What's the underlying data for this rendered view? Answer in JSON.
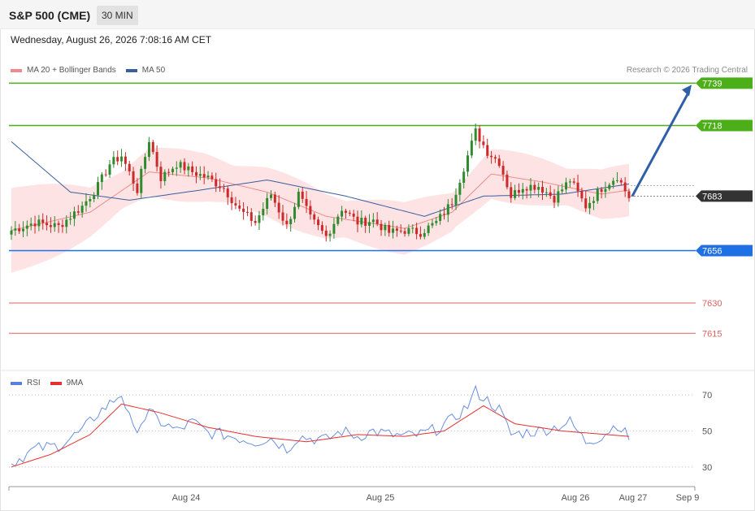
{
  "header": {
    "title": "S&P 500 (CME)",
    "interval": "30 MIN"
  },
  "datetime": "Wednesday, August 26, 2026 7:08:16 AM CET",
  "legend": {
    "ma20": "MA 20 + Bollinger Bands",
    "ma50": "MA 50"
  },
  "rsi_legend": {
    "rsi": "RSI",
    "ma9": "9MA"
  },
  "copyright": "Research © 2026 Trading Central",
  "colors": {
    "bull": "#2e8b2e",
    "bear": "#cc2a2a",
    "band": "#fde3e3",
    "ma20": "#f08a8a",
    "ma50": "#3a5fa0",
    "arrow": "#2f5fa8",
    "resistance": "#4caf1a",
    "support": "#1f6fe5",
    "redline": "#e06060",
    "current": "#333333",
    "rsi": "#6a8fe0",
    "rsi_ma": "#e53030"
  },
  "chart_data": [
    {
      "type": "candlestick",
      "title": "S&P 500 (CME)",
      "interval": "30 MIN",
      "ylim": [
        7597,
        7748
      ],
      "x_ticks": [
        "Aug 24",
        "Aug 25",
        "Aug 26",
        "Aug 27",
        "Sep 9"
      ],
      "y_levels": [
        {
          "value": 7739,
          "label": "7739",
          "kind": "resistance"
        },
        {
          "value": 7718,
          "label": "7718",
          "kind": "resistance"
        },
        {
          "value": 7683,
          "label": "7683",
          "kind": "current"
        },
        {
          "value": 7656,
          "label": "7656",
          "kind": "support"
        },
        {
          "value": 7630,
          "label": "7630",
          "kind": "redline"
        },
        {
          "value": 7615,
          "label": "7615",
          "kind": "redline"
        }
      ],
      "arrow": {
        "from": 7683,
        "to": 7739
      },
      "anchors": [
        [
          0,
          7666
        ],
        [
          6,
          7670
        ],
        [
          12,
          7668
        ],
        [
          18,
          7678
        ],
        [
          22,
          7688
        ],
        [
          25,
          7699
        ],
        [
          28,
          7703
        ],
        [
          32,
          7686
        ],
        [
          35,
          7711
        ],
        [
          38,
          7692
        ],
        [
          42,
          7699
        ],
        [
          46,
          7695
        ],
        [
          50,
          7692
        ],
        [
          54,
          7687
        ],
        [
          58,
          7676
        ],
        [
          62,
          7670
        ],
        [
          66,
          7684
        ],
        [
          70,
          7668
        ],
        [
          73,
          7684
        ],
        [
          76,
          7672
        ],
        [
          80,
          7663
        ],
        [
          84,
          7677
        ],
        [
          88,
          7670
        ],
        [
          92,
          7671
        ],
        [
          96,
          7665
        ],
        [
          100,
          7666
        ],
        [
          104,
          7665
        ],
        [
          108,
          7670
        ],
        [
          112,
          7680
        ],
        [
          116,
          7703
        ],
        [
          118,
          7715
        ],
        [
          121,
          7705
        ],
        [
          124,
          7700
        ],
        [
          127,
          7683
        ],
        [
          130,
          7688
        ],
        [
          134,
          7688
        ],
        [
          138,
          7682
        ],
        [
          142,
          7691
        ],
        [
          146,
          7678
        ],
        [
          150,
          7687
        ],
        [
          154,
          7693
        ],
        [
          157,
          7682
        ]
      ],
      "ma20_anchors": [
        [
          0,
          7666
        ],
        [
          20,
          7675
        ],
        [
          35,
          7695
        ],
        [
          50,
          7692
        ],
        [
          65,
          7685
        ],
        [
          80,
          7673
        ],
        [
          100,
          7667
        ],
        [
          112,
          7675
        ],
        [
          122,
          7694
        ],
        [
          135,
          7690
        ],
        [
          150,
          7684
        ],
        [
          157,
          7686
        ]
      ],
      "ma50_anchors": [
        [
          0,
          7710
        ],
        [
          15,
          7685
        ],
        [
          30,
          7681
        ],
        [
          48,
          7686
        ],
        [
          65,
          7691
        ],
        [
          85,
          7683
        ],
        [
          105,
          7673
        ],
        [
          120,
          7683
        ],
        [
          140,
          7684
        ],
        [
          157,
          7689
        ]
      ]
    },
    {
      "type": "line",
      "name": "RSI",
      "ylim": [
        20,
        80
      ],
      "y_ticks": [
        30,
        50,
        70
      ],
      "rsi_anchors": [
        [
          0,
          32
        ],
        [
          6,
          40
        ],
        [
          12,
          42
        ],
        [
          18,
          50
        ],
        [
          22,
          60
        ],
        [
          25,
          65
        ],
        [
          28,
          71
        ],
        [
          31,
          50
        ],
        [
          35,
          60
        ],
        [
          38,
          55
        ],
        [
          42,
          50
        ],
        [
          46,
          55
        ],
        [
          50,
          49
        ],
        [
          54,
          48
        ],
        [
          58,
          46
        ],
        [
          62,
          44
        ],
        [
          66,
          46
        ],
        [
          70,
          40
        ],
        [
          73,
          47
        ],
        [
          76,
          46
        ],
        [
          80,
          45
        ],
        [
          84,
          50
        ],
        [
          88,
          47
        ],
        [
          92,
          50
        ],
        [
          96,
          48
        ],
        [
          100,
          47
        ],
        [
          104,
          48
        ],
        [
          108,
          51
        ],
        [
          112,
          56
        ],
        [
          116,
          64
        ],
        [
          118,
          72
        ],
        [
          121,
          67
        ],
        [
          124,
          62
        ],
        [
          127,
          48
        ],
        [
          130,
          49
        ],
        [
          134,
          50
        ],
        [
          138,
          52
        ],
        [
          142,
          55
        ],
        [
          146,
          44
        ],
        [
          150,
          47
        ],
        [
          154,
          54
        ],
        [
          157,
          46
        ]
      ],
      "ma9_anchors": [
        [
          0,
          30
        ],
        [
          10,
          37
        ],
        [
          20,
          48
        ],
        [
          28,
          65
        ],
        [
          38,
          60
        ],
        [
          50,
          52
        ],
        [
          62,
          47
        ],
        [
          75,
          44
        ],
        [
          88,
          48
        ],
        [
          100,
          47
        ],
        [
          110,
          50
        ],
        [
          120,
          64
        ],
        [
          128,
          54
        ],
        [
          140,
          50
        ],
        [
          157,
          47
        ]
      ]
    }
  ]
}
